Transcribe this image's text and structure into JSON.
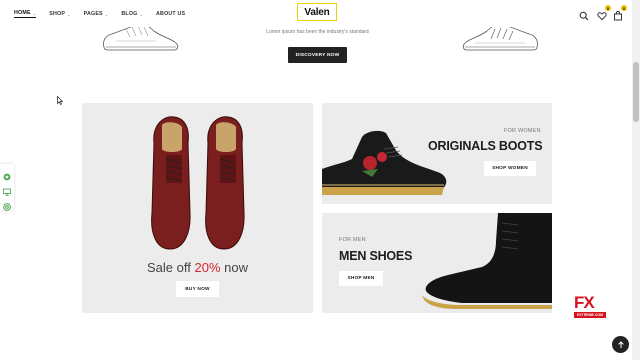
{
  "nav": {
    "items": [
      {
        "label": "HOME",
        "dropdown": true
      },
      {
        "label": "SHOP",
        "dropdown": true
      },
      {
        "label": "PAGES",
        "dropdown": true
      },
      {
        "label": "BLOG",
        "dropdown": true
      },
      {
        "label": "ABOUT US",
        "dropdown": false
      }
    ]
  },
  "logo": {
    "text": "Valen"
  },
  "header_icons": {
    "wishlist_count": "0",
    "cart_count": "0"
  },
  "hero": {
    "text": "Lorem ipsum has been the industry's standard",
    "button_label": "DISCOVERY NOW"
  },
  "banner_left": {
    "sale_prefix": "Sale off ",
    "sale_percent": "20%",
    "sale_suffix": " now",
    "button_label": "BUY NOW"
  },
  "banner_women": {
    "kicker": "FOR WOMEN",
    "title": "ORIGINALS BOOTS",
    "button_label": "SHOP WOMEN"
  },
  "banner_men": {
    "kicker": "FOR MEN",
    "title": "MEN SHOES",
    "button_label": "SHOP MEN"
  },
  "watermark": {
    "main": "FX",
    "sub": "EXTREME.COM"
  },
  "colors": {
    "accent": "#e8c200",
    "sale_red": "#d2262e",
    "dark": "#222222",
    "panel": "#ececec"
  }
}
